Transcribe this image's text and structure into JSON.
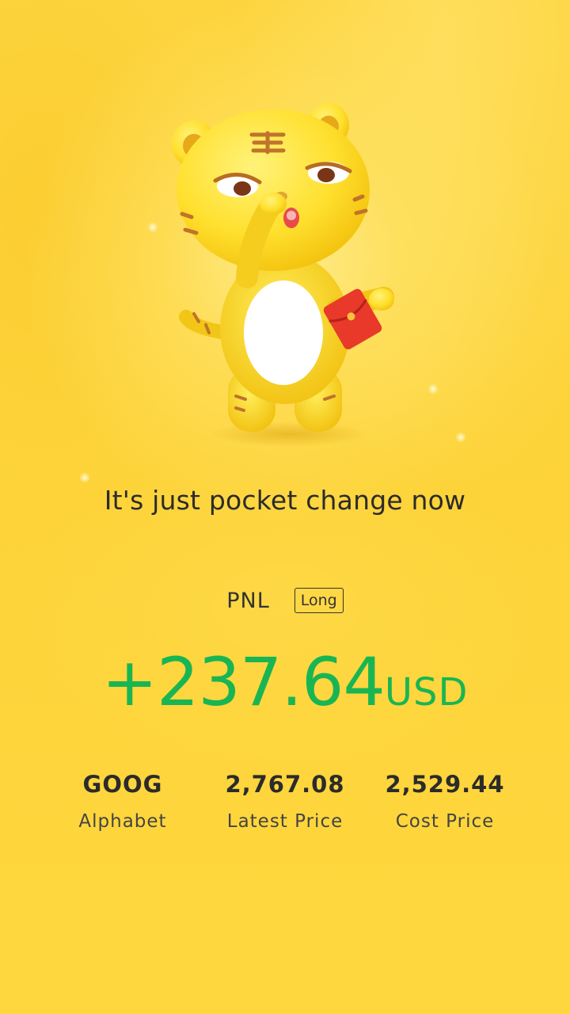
{
  "headline": "It's just pocket change now",
  "pnl": {
    "label": "PNL",
    "position": "Long",
    "amount": "+237.64",
    "currency": "USD",
    "color": "#19B553"
  },
  "stock": {
    "symbol": "GOOG",
    "name": "Alphabet",
    "latest_price": "2,767.08",
    "latest_price_label": "Latest Price",
    "cost_price": "2,529.44",
    "cost_price_label": "Cost Price"
  },
  "mascot": {
    "icon": "tiger-mascot-holding-red-envelope-icon"
  },
  "colors": {
    "background": "#FDD237",
    "text": "#2B2B2B",
    "envelope": "#E8392B"
  }
}
